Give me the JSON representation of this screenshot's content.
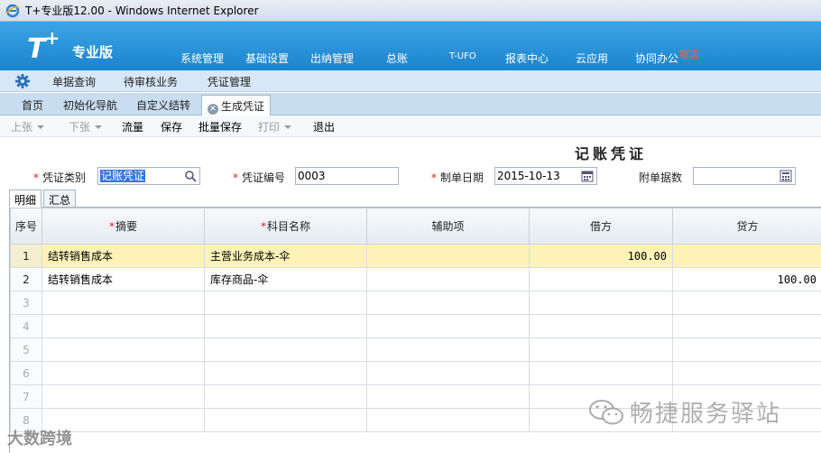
{
  "window": {
    "title": "T+专业版12.00 - Windows Internet Explorer"
  },
  "header": {
    "logo": "T",
    "logo_plus": "+",
    "edition": "专业版",
    "menu": [
      {
        "label": "系统管理"
      },
      {
        "label": "基础设置"
      },
      {
        "label": "出纳管理"
      },
      {
        "label": "总账"
      },
      {
        "label": "T-UFO"
      },
      {
        "label": "报表中心"
      },
      {
        "label": "云应用"
      },
      {
        "label": "协同办公"
      }
    ],
    "hot_badge": "喔选",
    "bg_color": "#1a84cf"
  },
  "subnav": {
    "items": [
      {
        "label": "单据查询"
      },
      {
        "label": "待审核业务"
      },
      {
        "label": "凭证管理"
      }
    ]
  },
  "tabs": [
    {
      "label": "首页"
    },
    {
      "label": "初始化导航"
    },
    {
      "label": "自定义结转"
    },
    {
      "label": "生成凭证",
      "active": true
    }
  ],
  "toolbar": {
    "prev": "上张",
    "next": "下张",
    "flow": "流量",
    "save": "保存",
    "batch_save": "批量保存",
    "print": "打印",
    "exit": "退出"
  },
  "form": {
    "title": "记账凭证",
    "voucher_type_label": "凭证类别",
    "voucher_type_value": "记账凭证",
    "voucher_no_label": "凭证编号",
    "voucher_no_value": "0003",
    "date_label": "制单日期",
    "date_value": "2015-10-13",
    "attachments_label": "附单据数",
    "attachments_value": "",
    "required_mark": "*"
  },
  "detail_tabs": [
    {
      "label": "明细",
      "active": true
    },
    {
      "label": "汇总"
    }
  ],
  "grid": {
    "columns": {
      "no": "序号",
      "summary": "摘要",
      "account": "科目名称",
      "aux": "辅助项",
      "debit": "借方",
      "credit": "贷方"
    },
    "rows": [
      {
        "no": "1",
        "summary": "结转销售成本",
        "account": "主营业务成本-伞",
        "aux": "",
        "debit": "100.00",
        "credit": ""
      },
      {
        "no": "2",
        "summary": "结转销售成本",
        "account": "库存商品-伞",
        "aux": "",
        "debit": "",
        "credit": "100.00"
      }
    ],
    "empty_rows": [
      "3",
      "4",
      "5",
      "6",
      "7",
      "8"
    ]
  },
  "watermarks": {
    "right": "畅捷服务驿站",
    "left": "大数跨境"
  }
}
